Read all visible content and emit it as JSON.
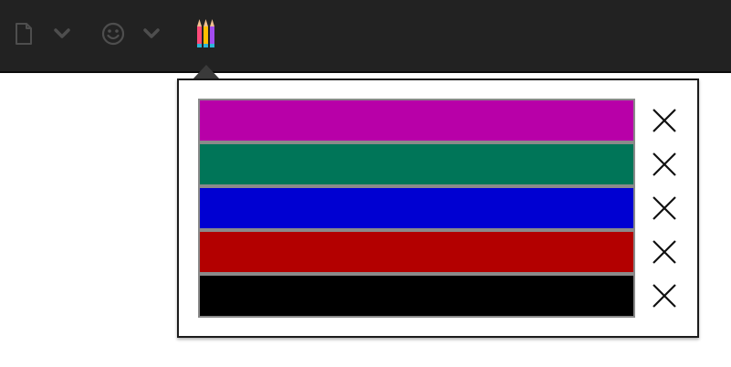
{
  "toolbar": {
    "icons": [
      "page-icon",
      "chevron-down-icon",
      "smiley-icon",
      "chevron-down-icon",
      "pencils-icon"
    ]
  },
  "color_list": {
    "colors": [
      {
        "name": "magenta",
        "hex": "#b800a8"
      },
      {
        "name": "teal",
        "hex": "#007558"
      },
      {
        "name": "blue",
        "hex": "#0000d2"
      },
      {
        "name": "red",
        "hex": "#b30000"
      },
      {
        "name": "black",
        "hex": "#000000"
      }
    ],
    "remove_icon": "close-icon"
  }
}
